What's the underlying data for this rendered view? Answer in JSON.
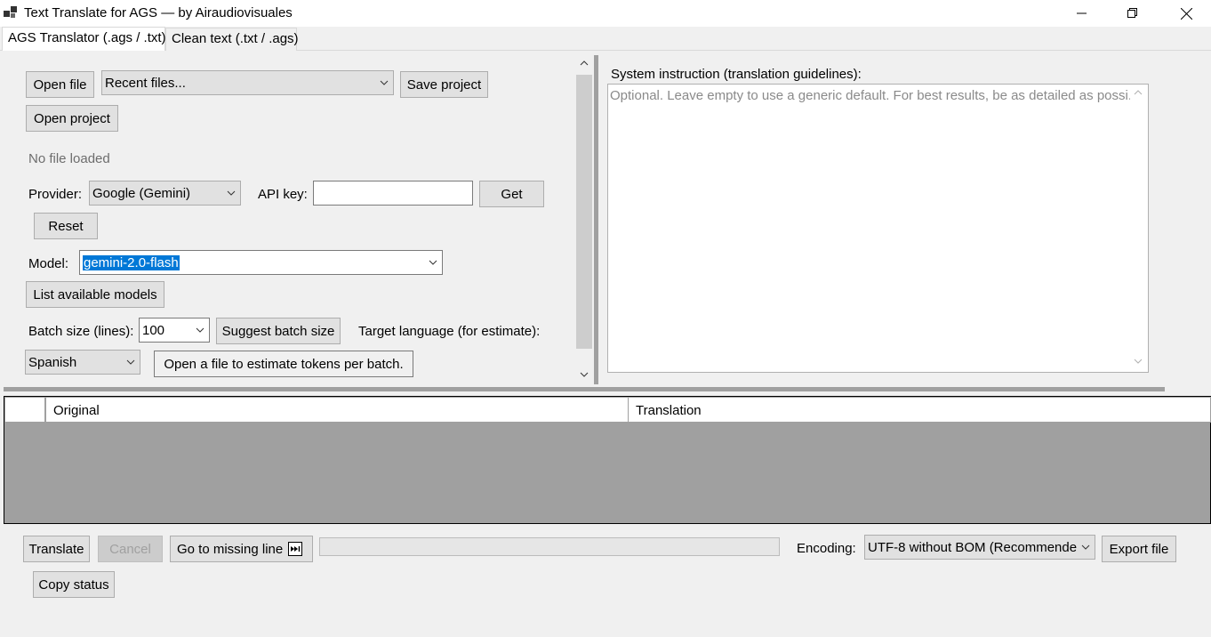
{
  "window": {
    "title": "Text Translate for AGS — by Airaudiovisuales"
  },
  "tabs": [
    {
      "label": "AGS Translator (.ags / .txt)",
      "active": true
    },
    {
      "label": "Clean text (.txt / .ags)",
      "active": false
    }
  ],
  "toolbar": {
    "open_file": "Open file",
    "recent_files": "Recent files...",
    "save_project": "Save project",
    "open_project": "Open project"
  },
  "status": {
    "file_status": "No file loaded"
  },
  "provider": {
    "label": "Provider:",
    "value": "Google (Gemini)",
    "api_key_label": "API key:",
    "api_key_value": "",
    "get_button": "Get",
    "reset_button": "Reset"
  },
  "model": {
    "label": "Model:",
    "value": "gemini-2.0-flash",
    "list_button": "List available models"
  },
  "batch": {
    "label": "Batch size (lines):",
    "value": "100",
    "suggest_button": "Suggest batch size",
    "target_language_label": "Target language (for estimate):",
    "target_language_value": "Spanish",
    "estimate_button": "Open a file to estimate tokens per batch."
  },
  "system_instruction": {
    "label": "System instruction (translation guidelines):",
    "placeholder": "Optional. Leave empty to use a generic default. For best results, be as detailed as possi..."
  },
  "grid": {
    "columns": [
      "",
      "Original",
      "Translation"
    ]
  },
  "bottom": {
    "translate": "Translate",
    "cancel": "Cancel",
    "go_to_missing": "Go to missing line",
    "encoding_label": "Encoding:",
    "encoding_value": "UTF-8 without BOM (Recommende",
    "export": "Export file",
    "copy_status": "Copy status",
    "progress": 0
  },
  "colors": {
    "selection": "#0078d7",
    "grid_background": "#a0a0a0",
    "window_background": "#f0f0f0"
  }
}
